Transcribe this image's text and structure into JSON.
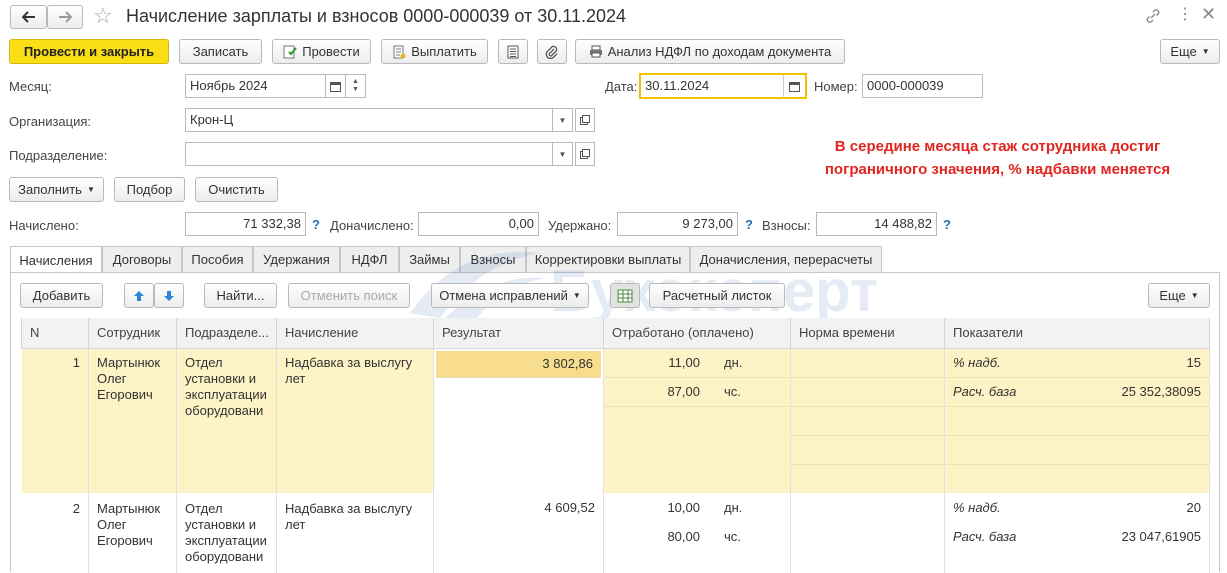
{
  "window": {
    "title": "Начисление зарплаты и взносов 0000-000039 от 30.11.2024"
  },
  "toolbar": {
    "post_close": "Провести и закрыть",
    "save": "Записать",
    "post": "Провести",
    "pay": "Выплатить",
    "ndfl_analysis": "Анализ НДФЛ по доходам документа",
    "more": "Еще"
  },
  "form": {
    "month_label": "Месяц:",
    "month_value": "Ноябрь 2024",
    "date_label": "Дата:",
    "date_value": "30.11.2024",
    "number_label": "Номер:",
    "number_value": "0000-000039",
    "org_label": "Организация:",
    "org_value": "Крон-Ц",
    "dept_label": "Подразделение:",
    "dept_value": "",
    "fill": "Заполнить",
    "select": "Подбор",
    "clear": "Очистить",
    "note": "В середине месяца стаж сотрудника достиг пограничного значения, % надбавки меняется"
  },
  "totals": {
    "accrued_label": "Начислено:",
    "accrued_value": "71 332,38",
    "extra_label": "Доначислено:",
    "extra_value": "0,00",
    "withheld_label": "Удержано:",
    "withheld_value": "9 273,00",
    "contrib_label": "Взносы:",
    "contrib_value": "14 488,82",
    "help": "?"
  },
  "tabs": [
    {
      "label": "Начисления"
    },
    {
      "label": "Договоры"
    },
    {
      "label": "Пособия"
    },
    {
      "label": "Удержания"
    },
    {
      "label": "НДФЛ"
    },
    {
      "label": "Займы"
    },
    {
      "label": "Взносы"
    },
    {
      "label": "Корректировки выплаты"
    },
    {
      "label": "Доначисления, перерасчеты"
    }
  ],
  "grid_toolbar": {
    "add": "Добавить",
    "find": "Найти...",
    "cancel_search": "Отменить поиск",
    "cancel_fixes": "Отмена исправлений",
    "payslip": "Расчетный листок",
    "more": "Еще"
  },
  "watermark": "Бухэксперт",
  "table": {
    "columns": [
      "N",
      "Сотрудник",
      "Подразделе...",
      "Начисление",
      "Результат",
      "Отработано (оплачено)",
      "Норма времени",
      "Показатели"
    ],
    "rows": [
      {
        "n": "1",
        "employee": "Мартынюк Олег Егорович",
        "dept": "Отдел установки и эксплуатации оборудовани",
        "accrual": "Надбавка за выслугу лет",
        "result": "3 802,86",
        "worked": [
          {
            "value": "11,00",
            "unit": "дн."
          },
          {
            "value": "87,00",
            "unit": "чс."
          }
        ],
        "indicators": [
          {
            "name": "% надб.",
            "value": "15"
          },
          {
            "name": "Расч. база",
            "value": "25 352,38095"
          }
        ]
      },
      {
        "n": "2",
        "employee": "Мартынюк Олег Егорович",
        "dept": "Отдел установки и эксплуатации оборудовани",
        "accrual": "Надбавка за выслугу лет",
        "result": "4 609,52",
        "worked": [
          {
            "value": "10,00",
            "unit": "дн."
          },
          {
            "value": "80,00",
            "unit": "чс."
          }
        ],
        "indicators": [
          {
            "name": "% надб.",
            "value": "20"
          },
          {
            "name": "Расч. база",
            "value": "23 047,61905"
          }
        ]
      }
    ]
  },
  "colors": {
    "primary_button": "#f9df14",
    "note_text": "#e0261f",
    "row_highlight": "#fdf3c6",
    "cell_highlight": "#f9dd8e",
    "help_mark": "#2570b8",
    "date_focus_border": "#f2c200"
  }
}
